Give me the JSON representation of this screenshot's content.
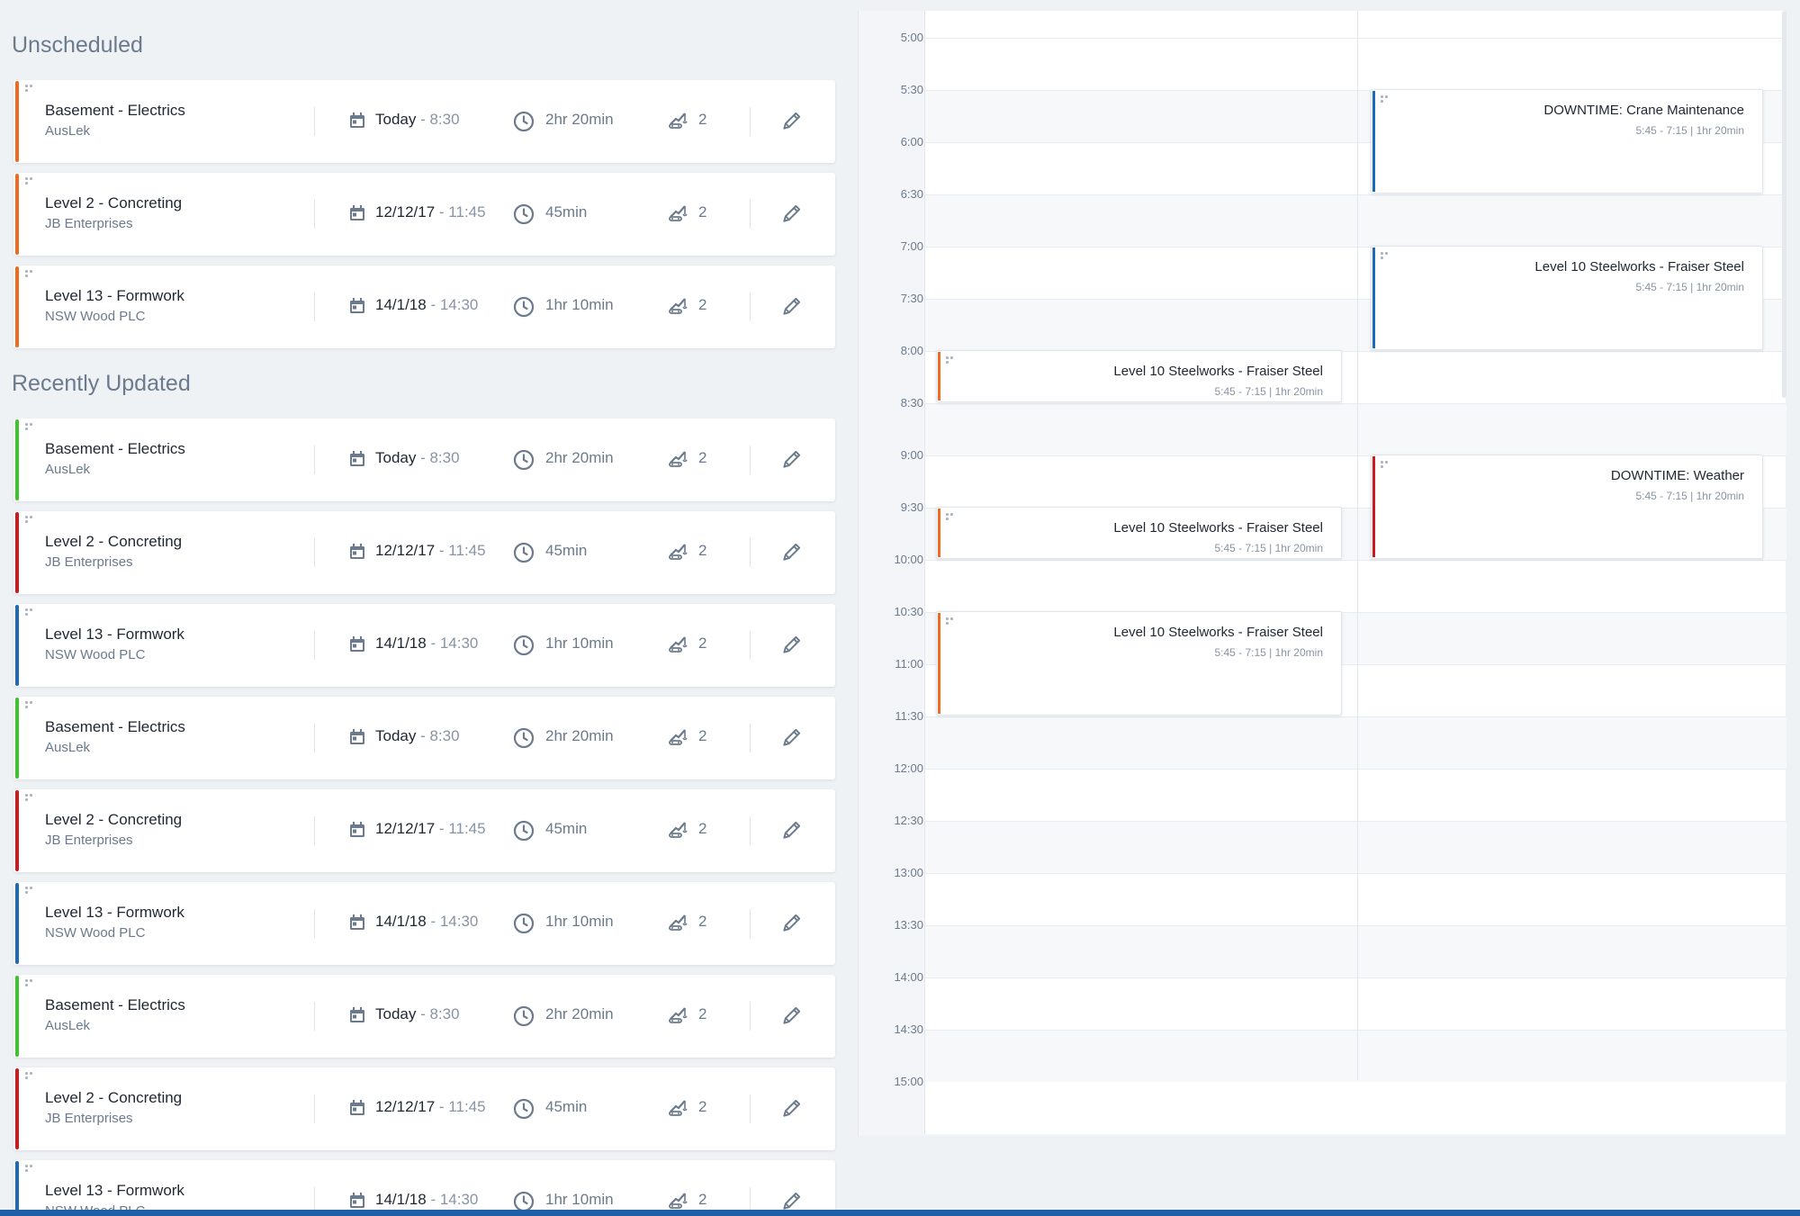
{
  "sections": {
    "unscheduled": "Unscheduled",
    "recently_updated": "Recently Updated"
  },
  "colors": {
    "orange": "#f06a22",
    "green": "#3cc62c",
    "red": "#d0191e",
    "blue": "#1c6bb8",
    "accent_bar": "#1f5fa8"
  },
  "icons": [
    "drag-handle-icon",
    "calendar-icon",
    "clock-icon",
    "crane-icon",
    "edit-pencil-icon"
  ],
  "unscheduled": [
    {
      "title": "Basement - Electrics",
      "company": "AusLek",
      "date": "Today",
      "time": " - 8:30",
      "duration": "2hr 20min",
      "count": "2",
      "color": "orange"
    },
    {
      "title": "Level 2 - Concreting",
      "company": "JB Enterprises",
      "date": "12/12/17",
      "time": " - 11:45",
      "duration": "45min",
      "count": "2",
      "color": "orange"
    },
    {
      "title": "Level 13 - Formwork",
      "company": "NSW Wood PLC",
      "date": "14/1/18",
      "time": " - 14:30",
      "duration": "1hr 10min",
      "count": "2",
      "color": "orange"
    }
  ],
  "recent": [
    {
      "title": "Basement - Electrics",
      "company": "AusLek",
      "date": "Today",
      "time": " - 8:30",
      "duration": "2hr 20min",
      "count": "2",
      "color": "green"
    },
    {
      "title": "Level 2 - Concreting",
      "company": "JB Enterprises",
      "date": "12/12/17",
      "time": " - 11:45",
      "duration": "45min",
      "count": "2",
      "color": "red"
    },
    {
      "title": "Level 13 - Formwork",
      "company": "NSW Wood PLC",
      "date": "14/1/18",
      "time": " - 14:30",
      "duration": "1hr 10min",
      "count": "2",
      "color": "blue"
    },
    {
      "title": "Basement - Electrics",
      "company": "AusLek",
      "date": "Today",
      "time": " - 8:30",
      "duration": "2hr 20min",
      "count": "2",
      "color": "green"
    },
    {
      "title": "Level 2 - Concreting",
      "company": "JB Enterprises",
      "date": "12/12/17",
      "time": " - 11:45",
      "duration": "45min",
      "count": "2",
      "color": "red"
    },
    {
      "title": "Level 13 - Formwork",
      "company": "NSW Wood PLC",
      "date": "14/1/18",
      "time": " - 14:30",
      "duration": "1hr 10min",
      "count": "2",
      "color": "blue"
    },
    {
      "title": "Basement - Electrics",
      "company": "AusLek",
      "date": "Today",
      "time": " - 8:30",
      "duration": "2hr 20min",
      "count": "2",
      "color": "green"
    },
    {
      "title": "Level 2 - Concreting",
      "company": "JB Enterprises",
      "date": "12/12/17",
      "time": " - 11:45",
      "duration": "45min",
      "count": "2",
      "color": "red"
    },
    {
      "title": "Level 13 - Formwork",
      "company": "NSW Wood PLC",
      "date": "14/1/18",
      "time": " - 14:30",
      "duration": "1hr 10min",
      "count": "2",
      "color": "blue"
    }
  ],
  "calendar": {
    "times": [
      "5:00",
      "5:30",
      "6:00",
      "6:30",
      "7:00",
      "7:30",
      "8:00",
      "8:30",
      "9:00",
      "9:30",
      "10:00",
      "10:30",
      "11:00",
      "11:30",
      "12:00",
      "12:30",
      "13:00",
      "13:30",
      "14:00",
      "14:30",
      "15:00"
    ],
    "events": [
      {
        "title": "DOWNTIME: Crane Maintenance",
        "meta": "5:45 - 7:15  |  1hr 20min",
        "column": 2,
        "start": "5:30",
        "end": "6:30",
        "color": "blue"
      },
      {
        "title": "Level 10 Steelworks - Fraiser Steel",
        "meta": "5:45 - 7:15  |  1hr 20min",
        "column": 2,
        "start": "7:00",
        "end": "8:00",
        "color": "blue"
      },
      {
        "title": "Level 10 Steelworks - Fraiser Steel",
        "meta": "5:45 - 7:15  |  1hr 20min",
        "column": 1,
        "start": "8:00",
        "end": "8:30",
        "color": "orange"
      },
      {
        "title": "DOWNTIME: Weather",
        "meta": "5:45 - 7:15  |  1hr 20min",
        "column": 2,
        "start": "9:00",
        "end": "10:00",
        "color": "red"
      },
      {
        "title": "Level 10 Steelworks - Fraiser Steel",
        "meta": "5:45 - 7:15  |  1hr 20min",
        "column": 1,
        "start": "9:30",
        "end": "10:00",
        "color": "orange"
      },
      {
        "title": "Level 10 Steelworks - Fraiser Steel",
        "meta": "5:45 - 7:15  |  1hr 20min",
        "column": 1,
        "start": "10:30",
        "end": "11:30",
        "color": "orange"
      }
    ]
  }
}
